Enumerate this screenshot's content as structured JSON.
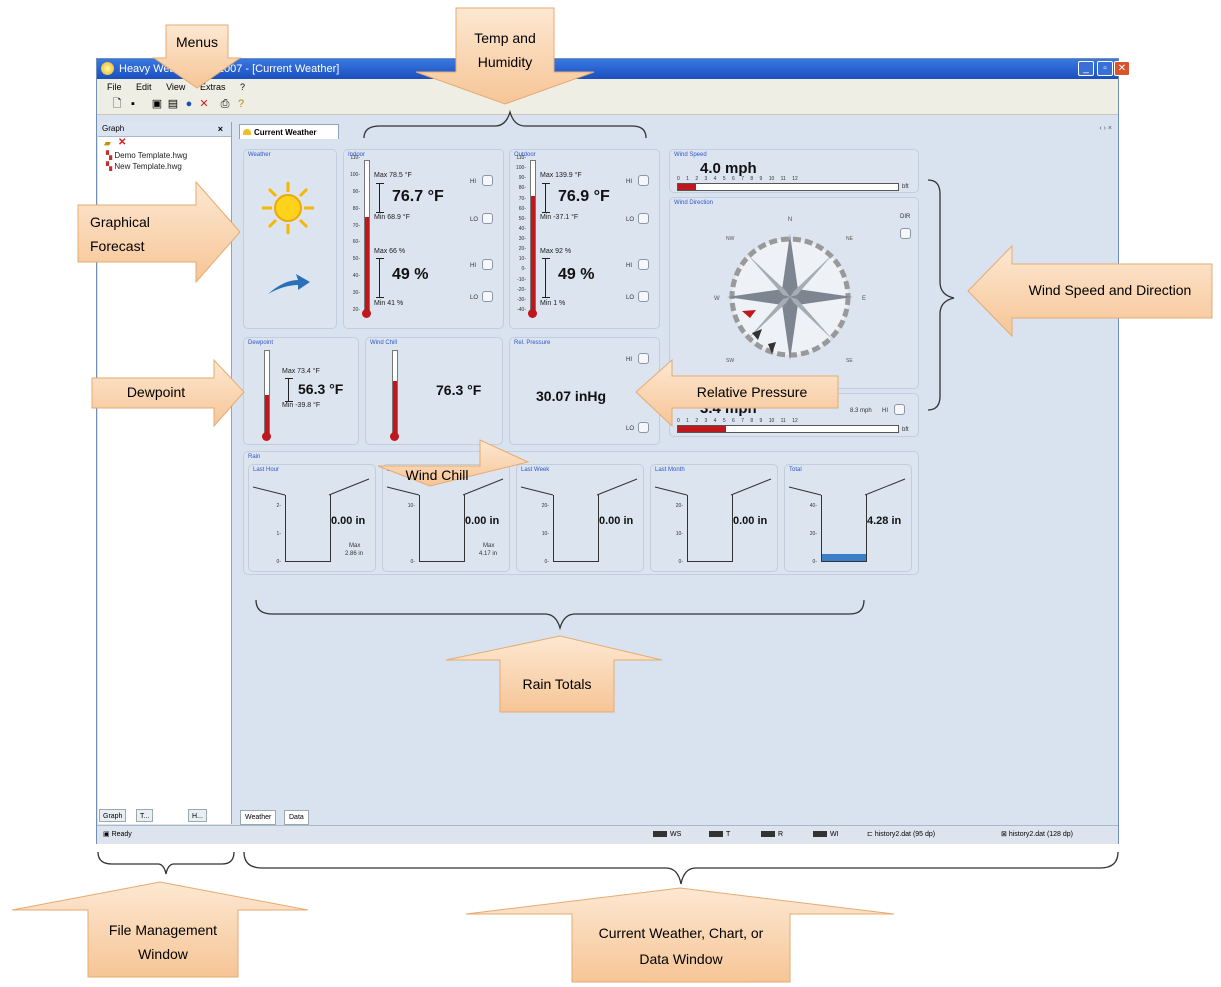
{
  "window": {
    "title": "Heavy Weather Pro 2007 - [Current Weather]",
    "controls": [
      "_",
      "▫",
      "✕"
    ]
  },
  "menu": [
    "File",
    "Edit",
    "View",
    "Extras",
    "?"
  ],
  "left_pane": {
    "header": "Graph",
    "close": "×",
    "files": [
      "Demo Template.hwg",
      "New Template.hwg"
    ],
    "tabs": [
      "Graph",
      "T...",
      "H..."
    ]
  },
  "doc_tab": "Current Weather",
  "bottom_tabs": [
    "Weather",
    "Data"
  ],
  "panels": {
    "weather": {
      "title": "Weather"
    },
    "indoor": {
      "title": "Indoor",
      "temp_max": "Max 78.5 °F",
      "temp": "76.7 °F",
      "temp_min": "Min 68.9 °F",
      "hum_max": "Max 66 %",
      "hum": "49 %",
      "hum_min": "Min 41 %",
      "hi": "HI",
      "lo": "LO",
      "scale": [
        "110-",
        "100-",
        "90-",
        "80-",
        "70-",
        "60-",
        "50-",
        "40-",
        "30-",
        "20-"
      ]
    },
    "outdoor": {
      "title": "Outdoor",
      "temp_max": "Max 139.9 °F",
      "temp": "76.9 °F",
      "temp_min": "Min -37.1 °F",
      "hum_max": "Max 92 %",
      "hum": "49 %",
      "hum_min": "Min 1 %",
      "hi": "HI",
      "lo": "LO",
      "scale": [
        "110-",
        "100-",
        "90-",
        "80-",
        "70-",
        "60-",
        "50-",
        "40-",
        "30-",
        "20-",
        "10-",
        "0-",
        "-10-",
        "-20-",
        "-30-",
        "-40-"
      ]
    },
    "wind_speed": {
      "title": "Wind Speed",
      "value": "4.0 mph",
      "unit": "bft",
      "ticks": "0  1  2  3  4  5  6  7  8  9  10  11  12",
      "level": 0.08
    },
    "wind_direction": {
      "title": "Wind Direction",
      "dir": "DIR",
      "n": "N",
      "s": "S",
      "e": "E",
      "w": "W",
      "nw": "NW",
      "ne": "NE",
      "sw": "SW",
      "se": "SE"
    },
    "gust": {
      "value": "3.4 mph",
      "max": "8.3 mph",
      "hi": "HI",
      "unit": "bft",
      "ticks": "0  1  2  3  4  5  6  7  8  9  10  11  12",
      "level": 0.22
    },
    "dewpoint": {
      "title": "Dewpoint",
      "max": "Max 73.4 °F",
      "value": "56.3 °F",
      "min": "Min -39.8 °F"
    },
    "wind_chill": {
      "title": "Wind Chill",
      "value": "76.3 °F"
    },
    "pressure": {
      "title": "Rel. Pressure",
      "value": "30.07 inHg",
      "hi": "HI",
      "lo": "LO"
    },
    "rain": {
      "title": "Rain",
      "gauges": [
        {
          "title": "Last Hour",
          "value": "0.00 in",
          "max": "Max",
          "max_value": "2.86 in",
          "ticks": [
            "2-",
            "1-",
            "0-"
          ],
          "level": 0
        },
        {
          "title": "Last 24 Hours",
          "value": "0.00 in",
          "max": "Max",
          "max_value": "4.17 in",
          "ticks": [
            "10-",
            "0-"
          ],
          "level": 0
        },
        {
          "title": "Last Week",
          "value": "0.00 in",
          "ticks": [
            "20-",
            "10-",
            "0-"
          ],
          "level": 0
        },
        {
          "title": "Last Month",
          "value": "0.00 in",
          "ticks": [
            "20-",
            "10-",
            "0-"
          ],
          "level": 0
        },
        {
          "title": "Total",
          "value": "4.28 in",
          "ticks": [
            "40-",
            "20-",
            "0-"
          ],
          "level": 0.1
        }
      ]
    }
  },
  "status": {
    "ready": "Ready",
    "ws": "WS",
    "t": "T",
    "r": "R",
    "wi": "WI",
    "file1": "history2.dat (95 dp)",
    "file2": "history2.dat (128 dp)"
  },
  "callouts": {
    "menus": "Menus",
    "temp_humidity": [
      "Temp and",
      "Humidity"
    ],
    "graphical_forecast": [
      "Graphical",
      "Forecast"
    ],
    "dewpoint": "Dewpoint",
    "wind_chill": "Wind Chill",
    "relative_pressure": "Relative Pressure",
    "wind_speed_direction": "Wind Speed and Direction",
    "rain_totals": "Rain Totals",
    "file_management": [
      "File Management",
      "Window"
    ],
    "current_weather": [
      "Current Weather, Chart, or",
      "Data Window"
    ]
  }
}
